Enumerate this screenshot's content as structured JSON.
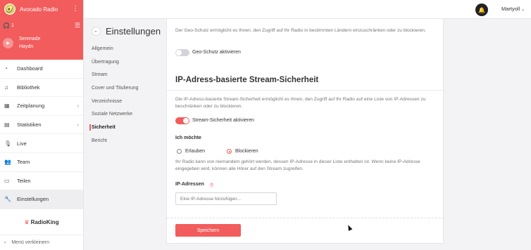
{
  "app": {
    "name": "Avocado Radio"
  },
  "player": {
    "listeners": "1",
    "track_title": "Serenade",
    "track_artist": "Haydn"
  },
  "nav": [
    {
      "label": "Dashboard",
      "icon": "dashboard-icon",
      "chevron": false
    },
    {
      "label": "Bibliothek",
      "icon": "music-note-icon",
      "chevron": false
    },
    {
      "label": "Zeitplanung",
      "icon": "calendar-icon",
      "chevron": true
    },
    {
      "label": "Statistiken",
      "icon": "chart-icon",
      "chevron": true
    },
    {
      "label": "Live",
      "icon": "microphone-icon",
      "chevron": false
    },
    {
      "label": "Team",
      "icon": "team-icon",
      "chevron": false
    },
    {
      "label": "Teilen",
      "icon": "share-icon",
      "chevron": false
    },
    {
      "label": "Einstellungen",
      "icon": "wrench-icon",
      "chevron": false
    }
  ],
  "brand": {
    "name": "RadioKing"
  },
  "collapse_label": "Menü verkleinern",
  "topbar": {
    "user": "Martyoll"
  },
  "settings": {
    "title": "Einstellungen",
    "menu": [
      "Allgemein",
      "Übertragung",
      "Stream",
      "Cover und Titulierung",
      "Verzeichnisse",
      "Soziale Netzwerke",
      "Sicherheit",
      "Bericht"
    ],
    "active": "Sicherheit"
  },
  "geo": {
    "description": "Der Geo-Schutz ermöglicht es Ihnen, den Zugriff auf Ihr Radio in bestimmten Ländern einzuschränken oder zu blockieren.",
    "toggle_label": "Geo-Schutz aktivieren",
    "enabled": false
  },
  "ip": {
    "heading": "IP-Adress-basierte Stream-Sicherheit",
    "description": "Die IP-Adress-basierte Stream-Sicherheit ermöglicht es Ihnen, den Zugriff auf Ihr Radio auf eine Liste von IP-Adressen zu beschränken oder zu blockieren.",
    "toggle_label": "Stream-Sicherheit aktivieren",
    "enabled": true,
    "choice_label": "Ich möchte",
    "options": [
      "Erlauben",
      "Blockieren"
    ],
    "selected": "Blockieren",
    "info": "Ihr Radio kann von niemandem gehört werden, dessen IP-Adresse in dieser Liste enthalten ist. Wenn keine IP-Adresse eingegeben wird, können alle Hörer auf den Stream zugreifen.",
    "field_label": "IP-Adressen",
    "placeholder": "Eine IP-Adresse hinzufügen..."
  },
  "save_label": "Speichern",
  "colors": {
    "accent": "#f25c5c"
  }
}
